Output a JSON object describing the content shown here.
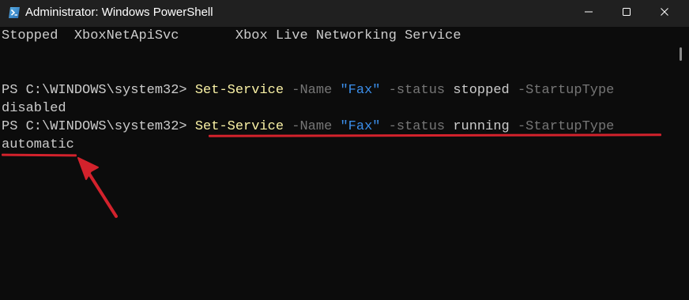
{
  "window": {
    "title": "Administrator: Windows PowerShell",
    "icon": "powershell-icon",
    "controls": {
      "minimize": "minimize-icon",
      "maximize": "maximize-icon",
      "close": "close-icon"
    }
  },
  "console": {
    "service_line": {
      "status": "Stopped",
      "name": "XboxNetApiSvc",
      "display_name": "Xbox Live Networking Service"
    },
    "commands": [
      {
        "prompt": "PS C:\\WINDOWS\\system32> ",
        "cmdlet": "Set-Service",
        "param_name": " -Name ",
        "name_value": "\"Fax\"",
        "param_status": " -status ",
        "status_value": "stopped",
        "param_startup": " -StartupType",
        "startup_value": "disabled"
      },
      {
        "prompt": "PS C:\\WINDOWS\\system32> ",
        "cmdlet": "Set-Service",
        "param_name": " -Name ",
        "name_value": "\"Fax\"",
        "param_status": " -status ",
        "status_value": "running",
        "param_startup": " -StartupType",
        "startup_value": "automatic"
      }
    ]
  },
  "colors": {
    "background": "#0c0c0c",
    "titlebar": "#202020",
    "cmdlet": "#f9f1a5",
    "parameter": "#767676",
    "string": "#3b8eea",
    "text": "#cccccc",
    "annotation": "#d3222c"
  },
  "annotations": {
    "underline": "red-underline",
    "arrow": "red-arrow-icon"
  }
}
